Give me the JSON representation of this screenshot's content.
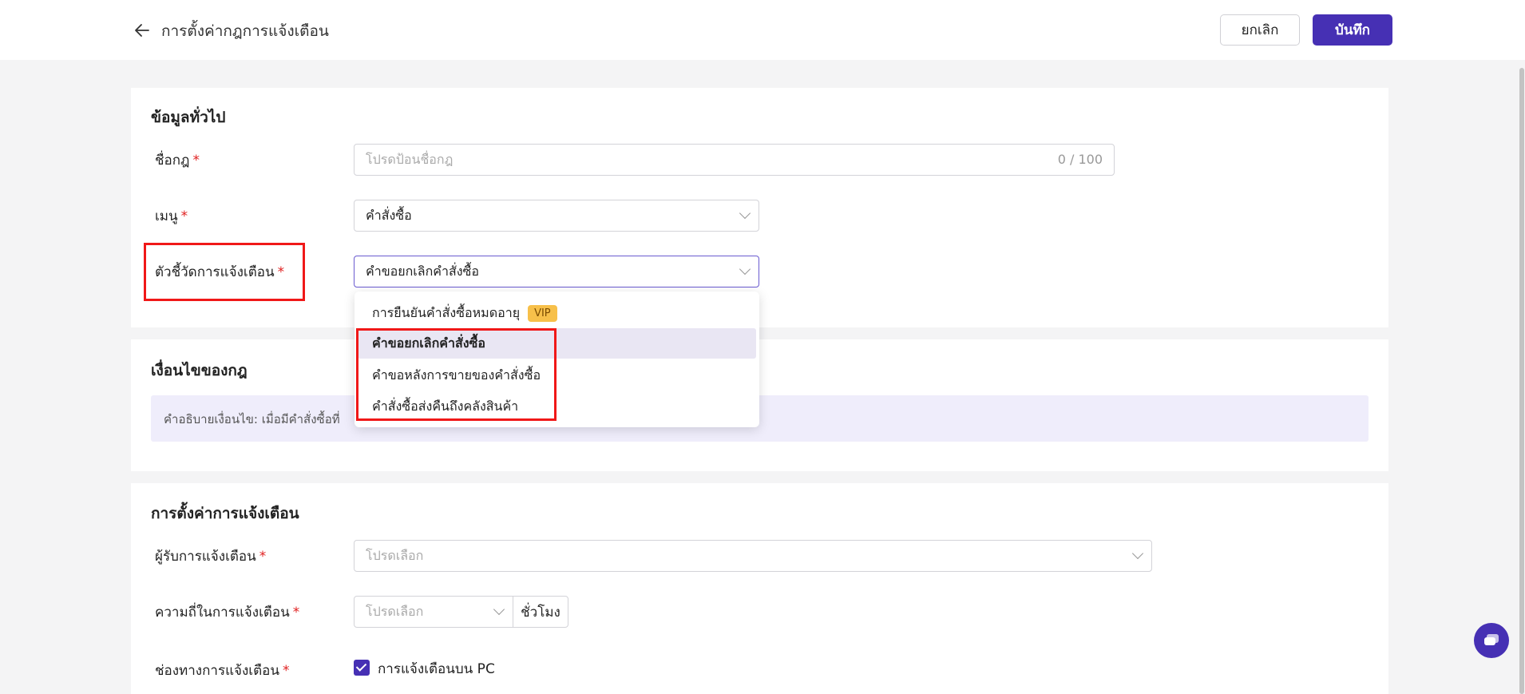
{
  "header": {
    "title": "การตั้งค่ากฎการแจ้งเตือน",
    "cancel_label": "ยกเลิก",
    "save_label": "บันทึก"
  },
  "general": {
    "section_title": "ข้อมูลทั่วไป",
    "rule_name": {
      "label": "ชื่อกฎ",
      "placeholder": "โปรดป้อนชื่อกฎ",
      "counter": "0 / 100"
    },
    "menu": {
      "label": "เมนู",
      "value": "คำสั่งซื้อ"
    },
    "metric": {
      "label": "ตัวชี้วัดการแจ้งเตือน",
      "value": "คำขอยกเลิกคำสั่งซื้อ",
      "options": [
        {
          "label": "การยืนยันคำสั่งซื้อหมดอายุ",
          "badge": "VIP"
        },
        {
          "label": "คำขอยกเลิกคำสั่งซื้อ",
          "selected": true
        },
        {
          "label": "คำขอหลังการขายของคำสั่งซื้อ"
        },
        {
          "label": "คำสั่งซื้อส่งคืนถึงคลังสินค้า"
        }
      ]
    }
  },
  "conditions": {
    "section_title": "เงื่อนไขของกฎ",
    "description": "คำอธิบายเงื่อนไข: เมื่อมีคำสั่งซื้อที่"
  },
  "notification": {
    "section_title": "การตั้งค่าการแจ้งเตือน",
    "recipients": {
      "label": "ผู้รับการแจ้งเตือน",
      "placeholder": "โปรดเลือก"
    },
    "frequency": {
      "label": "ความถี่ในการแจ้งเตือน",
      "placeholder": "โปรดเลือก",
      "unit": "ชั่วโมง"
    },
    "channel": {
      "label": "ช่องทางการแจ้งเตือน",
      "option": "การแจ้งเตือนบน PC",
      "checked": true
    }
  },
  "colors": {
    "primary": "#4630b4",
    "required": "#e02020",
    "highlight": "#f01818"
  }
}
